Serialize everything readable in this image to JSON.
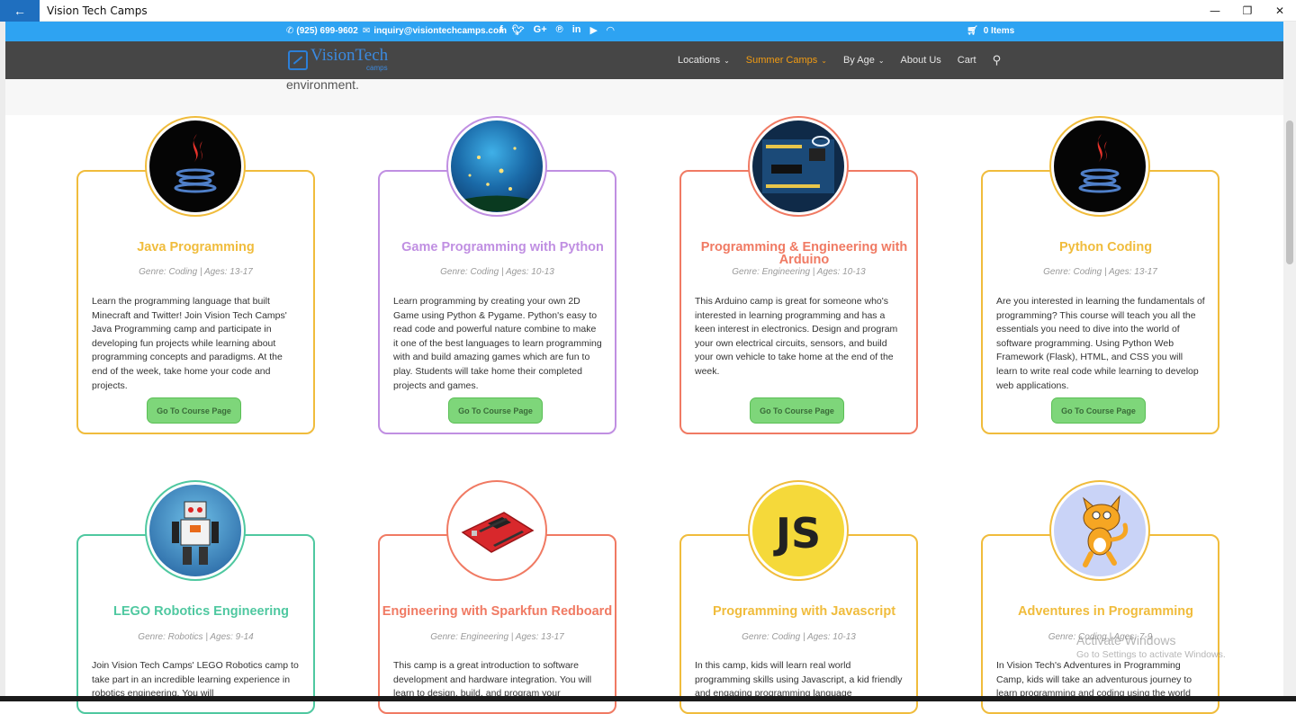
{
  "window": {
    "title": "Vision Tech Camps",
    "back": "←",
    "minimize": "—",
    "restore": "❐",
    "close": "✕"
  },
  "topbar": {
    "phone": "(925) 699-9602",
    "email": "inquiry@visiontechcamps.com",
    "socials": [
      "f",
      "t",
      "G+",
      "p",
      "in",
      "▶",
      "rss"
    ],
    "cart": "0 Items"
  },
  "nav": {
    "logo_main": "VisionTech",
    "logo_sub": "camps",
    "items": [
      {
        "label": "Locations",
        "dropdown": true,
        "active": false
      },
      {
        "label": "Summer Camps",
        "dropdown": true,
        "active": true
      },
      {
        "label": "By Age",
        "dropdown": true,
        "active": false
      },
      {
        "label": "About Us",
        "dropdown": false,
        "active": false
      },
      {
        "label": "Cart",
        "dropdown": false,
        "active": false
      }
    ]
  },
  "intro_tail": "environment.",
  "colors": {
    "yellow": "#f0bc3c",
    "purple": "#c08fe2",
    "red": "#f07a63",
    "green": "#4fc8a0",
    "topbar": "#2ea3f2",
    "nav": "#464646",
    "active": "#f39c12"
  },
  "courses": [
    {
      "title": "Java Programming",
      "genre": "Genre: Coding | Ages: 13-17",
      "desc": "Learn the programming language that built Minecraft and Twitter! Join Vision Tech Camps' Java Programming camp and participate in developing fun projects while learning about programming concepts and paradigms. At the end of the week, take home your code and projects.",
      "button": "Go To Course Page",
      "icon": "java-logo"
    },
    {
      "title": "Game Programming with Python",
      "genre": "Genre: Coding | Ages: 10-13",
      "desc": "Learn programming by creating your own 2D Game using Python & Pygame. Python's easy to read code and powerful nature combine to make it one of the best languages to learn programming with and build amazing games which are fun to play. Students will take home their completed projects and games.",
      "button": "Go To Course Page",
      "icon": "underwater-game-image"
    },
    {
      "title": "Programming & Engineering with Arduino",
      "genre": "Genre: Engineering | Ages: 10-13",
      "desc": "This Arduino camp is great for someone who's interested in learning programming and has a keen interest in electronics. Design and program your own electrical circuits, sensors, and build your own vehicle to take home at the end of the week.",
      "button": "Go To Course Page",
      "icon": "arduino-board"
    },
    {
      "title": "Python Coding",
      "genre": "Genre: Coding | Ages: 13-17",
      "desc": "Are you interested in learning the fundamentals of programming? This course will teach you all the essentials you need to dive into the world of software programming. Using Python Web Framework (Flask), HTML, and CSS you will learn to write real code while learning to develop web applications.",
      "button": "Go To Course Page",
      "icon": "java-logo"
    },
    {
      "title": "LEGO Robotics Engineering",
      "genre": "Genre: Robotics | Ages: 9-14",
      "desc": "Join Vision Tech Camps' LEGO Robotics camp to take part in an incredible learning experience in robotics engineering. You will",
      "button": "",
      "icon": "lego-robot"
    },
    {
      "title": "Engineering with Sparkfun Redboard",
      "genre": "Genre: Engineering | Ages: 13-17",
      "desc": "This camp is a great introduction to software development and hardware integration. You will learn to design, build, and program your",
      "button": "",
      "icon": "sparkfun-redboard"
    },
    {
      "title": "Programming with Javascript",
      "genre": "Genre: Coding | Ages: 10-13",
      "desc": "In this camp, kids will learn real world programming skills using Javascript, a kid friendly and engaging programming language",
      "button": "",
      "icon": "javascript-logo",
      "js_text": "JS"
    },
    {
      "title": "Adventures in Programming",
      "genre": "Genre: Coding | Ages: 7-9",
      "desc": "In Vision Tech's Adventures in Programming Camp, kids will take an adventurous journey to learn programming and coding using the world",
      "button": "",
      "icon": "scratch-cat"
    }
  ],
  "watermark": {
    "line1": "Activate Windows",
    "line2": "Go to Settings to activate Windows."
  }
}
